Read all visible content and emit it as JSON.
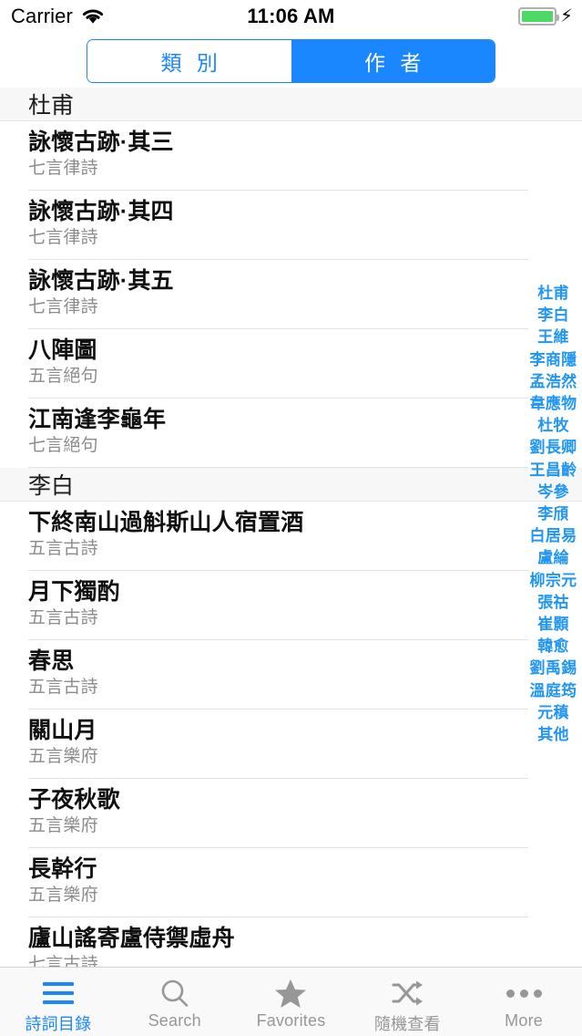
{
  "statusbar": {
    "carrier": "Carrier",
    "wifi_icon": "wifi-icon",
    "time": "11:06 AM",
    "battery_icon": "battery-full-icon",
    "charging_icon": "charging-bolt-icon"
  },
  "segmented_control": {
    "options": [
      {
        "label": "類 別",
        "selected": false
      },
      {
        "label": "作 者",
        "selected": true
      }
    ],
    "active_color": "#1a86ff",
    "inactive_text_color": "#1a86ff"
  },
  "list": {
    "sections": [
      {
        "header": "杜甫",
        "rows": [
          {
            "title": "詠懷古跡·其三",
            "subtitle": "七言律詩"
          },
          {
            "title": "詠懷古跡·其四",
            "subtitle": "七言律詩"
          },
          {
            "title": "詠懷古跡·其五",
            "subtitle": "七言律詩"
          },
          {
            "title": "八陣圖",
            "subtitle": "五言絕句"
          },
          {
            "title": "江南逢李龜年",
            "subtitle": "七言絕句"
          }
        ]
      },
      {
        "header": "李白",
        "rows": [
          {
            "title": "下終南山過斛斯山人宿置酒",
            "subtitle": "五言古詩"
          },
          {
            "title": "月下獨酌",
            "subtitle": "五言古詩"
          },
          {
            "title": "春思",
            "subtitle": "五言古詩"
          },
          {
            "title": "關山月",
            "subtitle": "五言樂府"
          },
          {
            "title": "子夜秋歌",
            "subtitle": "五言樂府"
          },
          {
            "title": "長幹行",
            "subtitle": "五言樂府"
          },
          {
            "title": "廬山謠寄盧侍禦虛舟",
            "subtitle": "七言古詩"
          }
        ]
      }
    ]
  },
  "section_index": {
    "color": "#2196f3",
    "items": [
      "杜甫",
      "李白",
      "王維",
      "李商隱",
      "孟浩然",
      "韋應物",
      "杜牧",
      "劉長卿",
      "王昌齡",
      "岑參",
      "李頎",
      "白居易",
      "盧綸",
      "柳宗元",
      "張祜",
      "崔顥",
      "韓愈",
      "劉禹錫",
      "溫庭筠",
      "元稹",
      "其他"
    ]
  },
  "tabbar": {
    "active_color": "#1a86ff",
    "inactive_color": "#979797",
    "tabs": [
      {
        "label": "詩詞目錄",
        "icon": "hamburger-menu-icon",
        "active": true
      },
      {
        "label": "Search",
        "icon": "search-icon",
        "active": false
      },
      {
        "label": "Favorites",
        "icon": "star-icon",
        "active": false
      },
      {
        "label": "隨機查看",
        "icon": "shuffle-icon",
        "active": false
      },
      {
        "label": "More",
        "icon": "ellipsis-icon",
        "active": false
      }
    ]
  }
}
